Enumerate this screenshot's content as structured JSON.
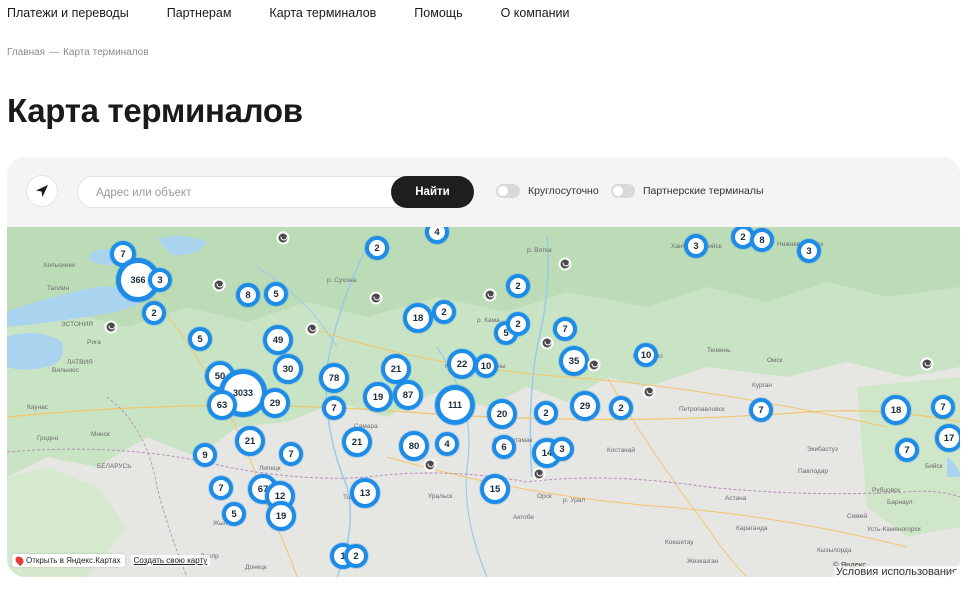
{
  "nav": {
    "items": [
      "Платежи и переводы",
      "Партнерам",
      "Карта терминалов",
      "Помощь",
      "О компании"
    ]
  },
  "breadcrumb": {
    "home": "Главная",
    "separator": "—",
    "current": "Карта терминалов"
  },
  "page": {
    "title": "Карта терминалов"
  },
  "search": {
    "placeholder": "Адрес или объект",
    "value": "",
    "button": "Найти"
  },
  "filters": {
    "round_the_clock": {
      "label": "Круглосуточно",
      "checked": false
    },
    "partner_terminals": {
      "label": "Партнерские терминалы",
      "checked": false
    }
  },
  "map": {
    "clusters": [
      "7",
      "366",
      "3",
      "2",
      "8",
      "5",
      "49",
      "5",
      "50",
      "30",
      "3033",
      "63",
      "29",
      "21",
      "9",
      "7",
      "67",
      "12",
      "19",
      "7",
      "5",
      "78",
      "7",
      "21",
      "19",
      "87",
      "21",
      "80",
      "4",
      "13",
      "1",
      "2",
      "111",
      "22",
      "10",
      "20",
      "6",
      "2",
      "18",
      "2",
      "2",
      "5",
      "2",
      "4",
      "7",
      "35",
      "14",
      "3",
      "29",
      "2",
      "10",
      "15",
      "3",
      "2",
      "8",
      "3",
      "7",
      "18",
      "7",
      "7",
      "17",
      "2"
    ],
    "labels": [
      "Хельсинки",
      "Таллин",
      "Рига",
      "Вильнюс",
      "Минск",
      "Каунас",
      "Гродно",
      "БЕЛАРУСЬ",
      "ЛАТВИЯ",
      "ЭСТОНИЯ",
      "Липецк",
      "Самара",
      "Уральск",
      "Актобе",
      "Орск",
      "Стерлитамак",
      "Набережные Челны",
      "Костанай",
      "Петропавловск",
      "Павлодар",
      "Астана",
      "Караганда",
      "Жезказган",
      "Семей",
      "Кызылорда",
      "Рубцовск",
      "Бийск",
      "Усть-Каменогорск",
      "Кокшетау",
      "Экибастуз",
      "Тольятти",
      "Жыл",
      "Донецк",
      "Днепр",
      "р. Сухона",
      "р. Кама",
      "р. Урал",
      "р. Вятка",
      "Ханты-Мансийск",
      "Нижневартовск",
      "Барнаул",
      "Кемерово",
      "Омск",
      "Тюмень",
      "Курган"
    ],
    "footer": {
      "open_in_yandex": "Открыть в Яндекс.Картах",
      "create_map": "Создать свою карту",
      "copyright": "© Яндекс",
      "terms": "Условия использования"
    }
  },
  "colors": {
    "cluster_ring": "#1e8ce6",
    "button_dark": "#1e1e1e",
    "page_bg": "#ffffff",
    "panel_bg": "#f4f4f4",
    "map_green": "#c6e3c4",
    "map_water": "#aad3f0"
  }
}
